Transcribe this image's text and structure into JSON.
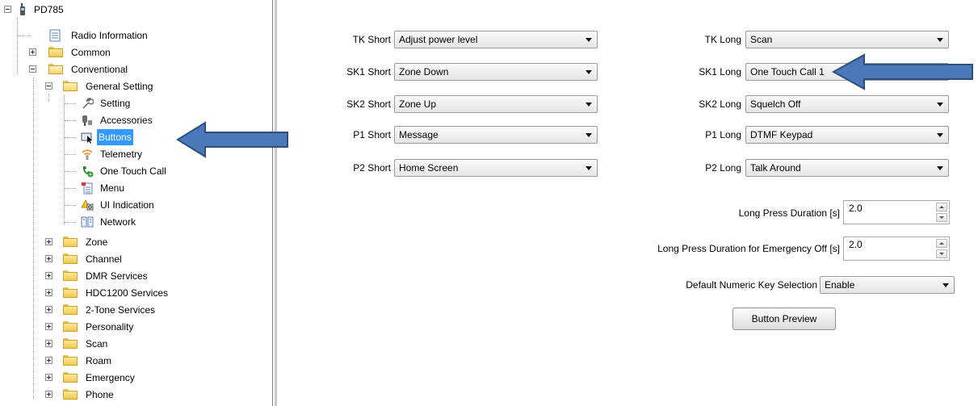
{
  "tree": {
    "root": "PD785",
    "items": [
      {
        "label": "Radio Information"
      },
      {
        "label": "Common"
      },
      {
        "label": "Conventional"
      },
      {
        "label": "General Setting"
      },
      {
        "label": "Setting"
      },
      {
        "label": "Accessories"
      },
      {
        "label": "Buttons"
      },
      {
        "label": "Telemetry"
      },
      {
        "label": "One Touch Call"
      },
      {
        "label": "Menu"
      },
      {
        "label": "UI Indication"
      },
      {
        "label": "Network"
      },
      {
        "label": "Zone"
      },
      {
        "label": "Channel"
      },
      {
        "label": "DMR Services"
      },
      {
        "label": "HDC1200 Services"
      },
      {
        "label": "2-Tone Services"
      },
      {
        "label": "Personality"
      },
      {
        "label": "Scan"
      },
      {
        "label": "Roam"
      },
      {
        "label": "Emergency"
      },
      {
        "label": "Phone"
      }
    ],
    "selected": "Buttons"
  },
  "short_buttons": [
    {
      "label": "TK Short",
      "value": "Adjust power level"
    },
    {
      "label": "SK1 Short",
      "value": "Zone Down"
    },
    {
      "label": "SK2 Short",
      "value": "Zone Up"
    },
    {
      "label": "P1 Short",
      "value": "Message"
    },
    {
      "label": "P2 Short",
      "value": "Home Screen"
    }
  ],
  "long_buttons": [
    {
      "label": "TK Long",
      "value": "Scan"
    },
    {
      "label": "SK1 Long",
      "value": "One Touch Call 1"
    },
    {
      "label": "SK2 Long",
      "value": "Squelch Off"
    },
    {
      "label": "P1 Long",
      "value": "DTMF Keypad"
    },
    {
      "label": "P2 Long",
      "value": "Talk Around"
    }
  ],
  "long_press": {
    "label": "Long Press Duration [s]",
    "value": "2.0"
  },
  "long_press_emergency": {
    "label": "Long Press Duration for Emergency Off [s]",
    "value": "2.0"
  },
  "default_numeric": {
    "label": "Default Numeric Key Selection",
    "value": "Enable"
  },
  "preview_button": "Button Preview",
  "colors": {
    "arrow": "#4a78b8",
    "arrow_border": "#2c4f80",
    "selection": "#3399ff"
  }
}
